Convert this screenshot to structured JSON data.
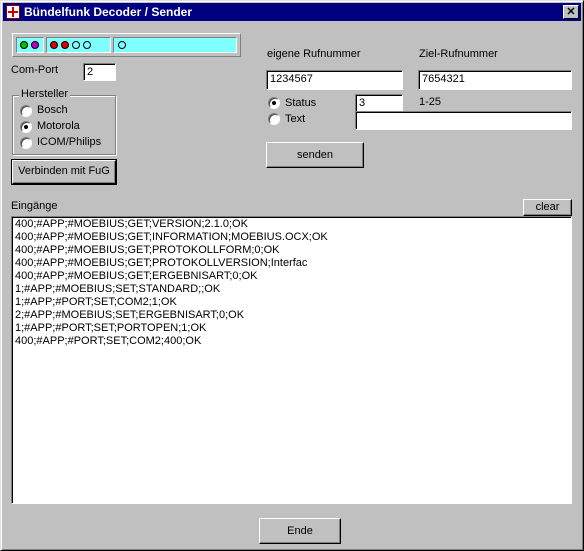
{
  "window": {
    "title": "Bündelfunk Decoder / Sender",
    "close_glyph": "✕"
  },
  "status_leds": [
    {
      "name": "led-green",
      "color": "#00c000"
    },
    {
      "name": "led-magenta",
      "color": "#c000c0"
    },
    {
      "name": "led-red-1",
      "color": "#e00000"
    },
    {
      "name": "led-red-2",
      "color": "#e00000"
    },
    {
      "name": "led-empty-1",
      "color": "#80ffff"
    },
    {
      "name": "led-empty-2",
      "color": "#80ffff"
    },
    {
      "name": "led-empty-3",
      "color": "#80ffff"
    }
  ],
  "comport": {
    "label": "Com-Port",
    "value": "2"
  },
  "hersteller": {
    "title": "Hersteller",
    "options": [
      {
        "label": "Bosch",
        "checked": false
      },
      {
        "label": "Motorola",
        "checked": true
      },
      {
        "label": "ICOM/Philips",
        "checked": false
      }
    ]
  },
  "connect_button": "Verbinden mit FuG",
  "own_number": {
    "label": "eigene Rufnummer",
    "value": "1234567"
  },
  "target_number": {
    "label": "Ziel-Rufnummer",
    "value": "7654321"
  },
  "mode": {
    "status_label": "Status",
    "status_value": "3",
    "status_range": "1-25",
    "text_label": "Text",
    "text_value": ""
  },
  "send_button": "senden",
  "incoming": {
    "label": "Eingänge",
    "clear_button": "clear",
    "lines": [
      "400;#APP;#MOEBIUS;GET;VERSION;2.1.0;OK",
      "400;#APP;#MOEBIUS;GET;INFORMATION;MOEBIUS.OCX;OK",
      "400;#APP;#MOEBIUS;GET;PROTOKOLLFORM;0;OK",
      "400;#APP;#MOEBIUS;GET;PROTOKOLLVERSION;Interfac",
      "400;#APP;#MOEBIUS;GET;ERGEBNISART;0;OK",
      "1;#APP;#MOEBIUS;SET;STANDARD;;OK",
      "1;#APP;#PORT;SET;COM2;1;OK",
      "2;#APP;#MOEBIUS;SET;ERGEBNISART;0;OK",
      "1;#APP;#PORT;SET;PORTOPEN;1;OK",
      "400;#APP;#PORT;SET;COM2;400;OK"
    ]
  },
  "end_button": "Ende"
}
